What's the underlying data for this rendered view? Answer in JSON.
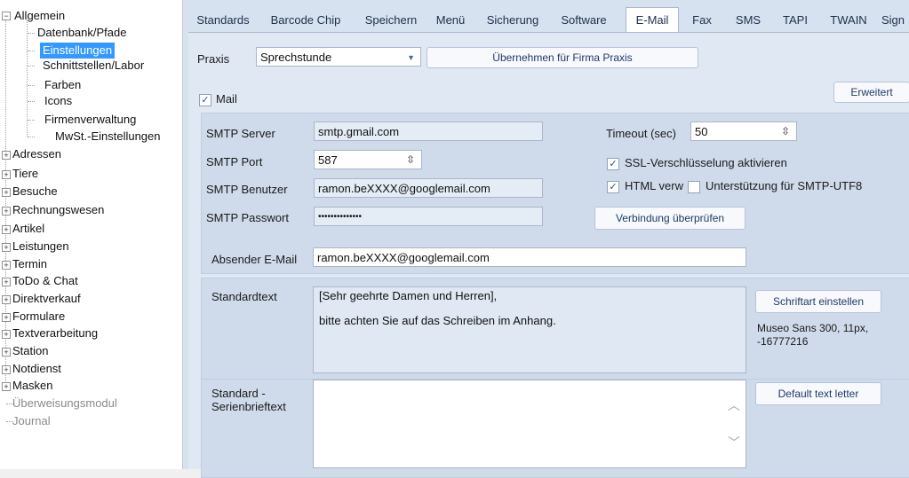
{
  "tree": {
    "root": "Allgemein",
    "children": [
      "Datenbank/Pfade",
      "Einstellungen",
      "Schnittstellen/Labor",
      "Farben",
      "Icons",
      "Firmenverwaltung",
      "MwSt.-Einstellungen"
    ],
    "groups": [
      "Adressen",
      "Tiere",
      "Besuche",
      "Rechnungswesen",
      "Artikel",
      "Leistungen",
      "Termin",
      "ToDo & Chat",
      "Direktverkauf",
      "Formulare",
      "Textverarbeitung",
      "Station",
      "Notdienst",
      "Masken"
    ],
    "disabled": [
      "Überweisungsmodul",
      "Journal"
    ],
    "expand_symbol": "+",
    "collapse_symbol": "−"
  },
  "tabs": [
    "Standards",
    "Barcode Chip",
    "Speichern",
    "Menü",
    "Sicherung",
    "Software",
    "E-Mail",
    "Fax",
    "SMS",
    "TAPI",
    "TWAIN",
    "Sign"
  ],
  "active_tab": "E-Mail",
  "praxis": {
    "label": "Praxis",
    "value": "Sprechstunde",
    "apply_button": "Übernehmen für Firma Praxis"
  },
  "mail": {
    "label": "Mail",
    "checked": "✓",
    "advanced_button": "Erweitert"
  },
  "smtp": {
    "server_label": "SMTP Server",
    "server_value": "smtp.gmail.com",
    "port_label": "SMTP Port",
    "port_value": "587",
    "user_label": "SMTP Benutzer",
    "user_value": "ramon.beXXXX@googlemail.com",
    "password_label": "SMTP Passwort",
    "password_value": "••••••••••••••",
    "timeout_label": "Timeout (sec)",
    "timeout_value": "50",
    "ssl_label": "SSL-Verschlüsselung aktivieren",
    "ssl_checked": "✓",
    "html_label": "HTML verw",
    "html_checked": "✓",
    "utf8_label": "Unterstützung für SMTP-UTF8",
    "check_button": "Verbindung überprüfen"
  },
  "sender": {
    "label": "Absender E-Mail",
    "value": "ramon.beXXXX@googlemail.com"
  },
  "standard_text": {
    "label": "Standardtext",
    "line1": "[Sehr geehrte Damen und Herren],",
    "line2": "bitte achten Sie auf das Schreiben im Anhang.",
    "font_button": "Schriftart einstellen",
    "font_info": "Museo Sans 300, 11px, -16777216"
  },
  "serial_text": {
    "label_line1": "Standard -",
    "label_line2": "Serienbrieftext",
    "button": "Default text letter"
  },
  "icons": {
    "dropdown": "chevron-down-icon",
    "spin": "spinner-icon",
    "scroll_up": "chevron-up-icon",
    "scroll_down": "chevron-down-icon"
  },
  "colors": {
    "selection": "#3399ff",
    "pane_bg": "#d6e2f0",
    "group_bg": "#cfdbea"
  }
}
